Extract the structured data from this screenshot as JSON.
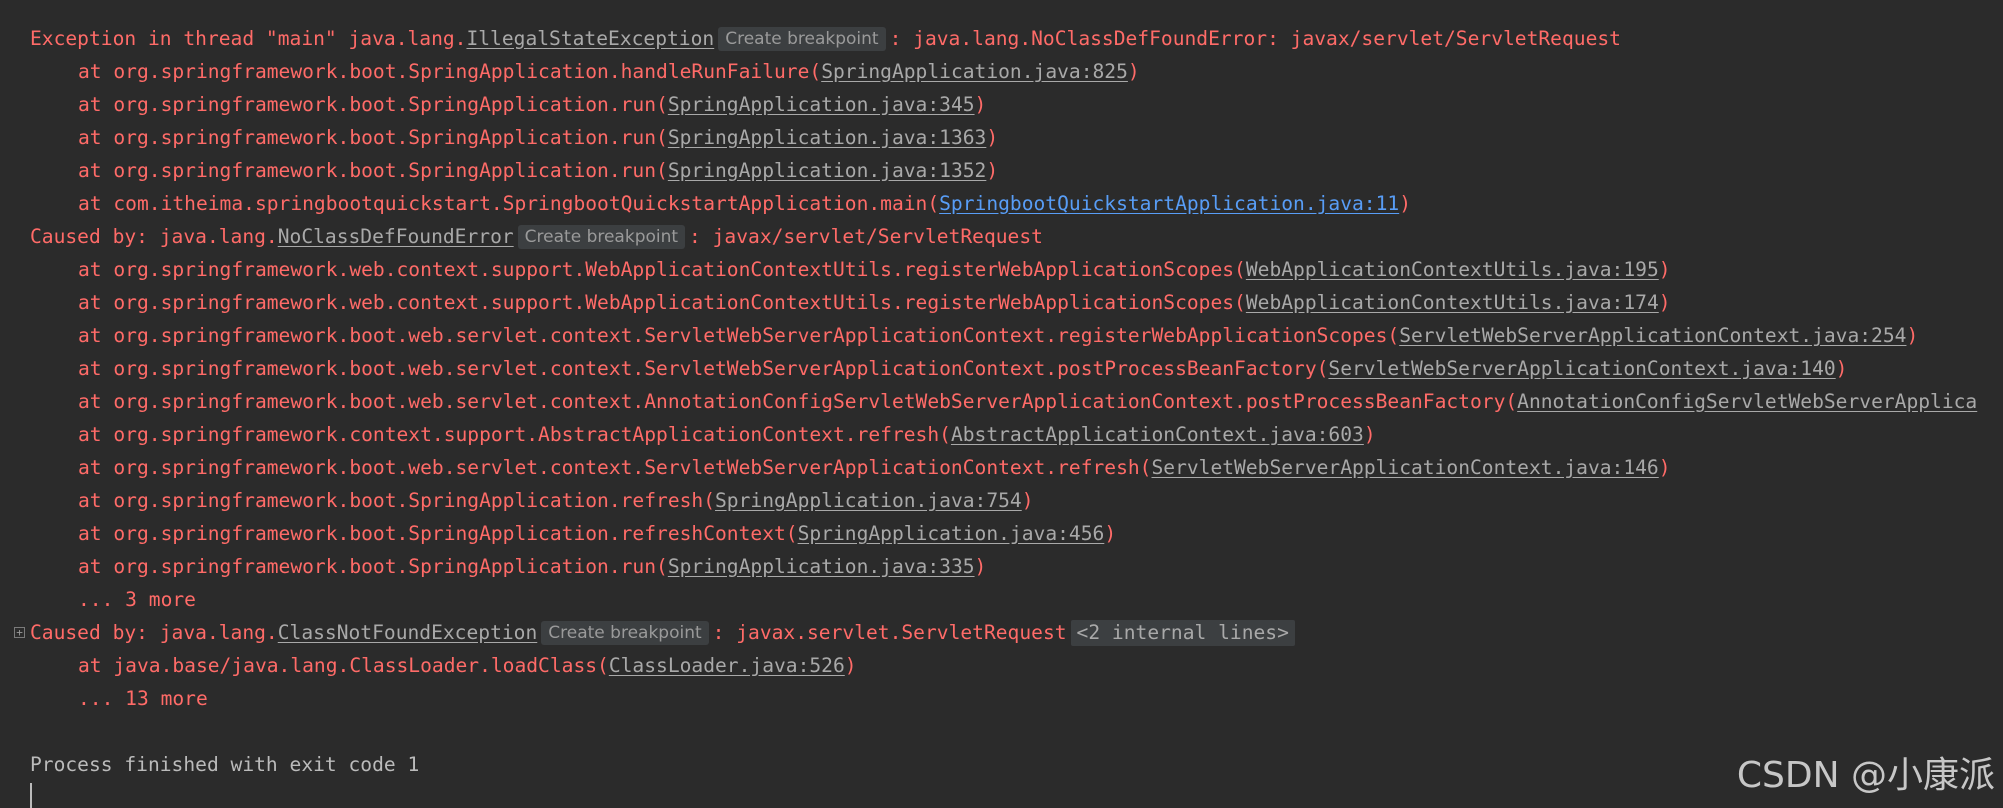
{
  "console": {
    "l1": {
      "prefix": "Exception in thread \"main\" java.lang.",
      "exception": "IllegalStateException",
      "hint": "Create breakpoint",
      "suffix": ": java.lang.NoClassDefFoundError: javax/servlet/ServletRequest"
    },
    "frames1": [
      {
        "method": "at org.springframework.boot.SpringApplication.handleRunFailure(",
        "location": "SpringApplication.java:825",
        "tail": ")"
      },
      {
        "method": "at org.springframework.boot.SpringApplication.run(",
        "location": "SpringApplication.java:345",
        "tail": ")"
      },
      {
        "method": "at org.springframework.boot.SpringApplication.run(",
        "location": "SpringApplication.java:1363",
        "tail": ")"
      },
      {
        "method": "at org.springframework.boot.SpringApplication.run(",
        "location": "SpringApplication.java:1352",
        "tail": ")"
      },
      {
        "method": "at com.itheima.springbootquickstart.SpringbootQuickstartApplication.main(",
        "location": "SpringbootQuickstartApplication.java:11",
        "tail": ")"
      }
    ],
    "cause1": {
      "prefix": "Caused by: java.lang.",
      "exception": "NoClassDefFoundError",
      "hint": "Create breakpoint",
      "suffix": ": javax/servlet/ServletRequest"
    },
    "frames2": [
      {
        "method": "at org.springframework.web.context.support.WebApplicationContextUtils.registerWebApplicationScopes(",
        "location": "WebApplicationContextUtils.java:195",
        "tail": ")"
      },
      {
        "method": "at org.springframework.web.context.support.WebApplicationContextUtils.registerWebApplicationScopes(",
        "location": "WebApplicationContextUtils.java:174",
        "tail": ")"
      },
      {
        "method": "at org.springframework.boot.web.servlet.context.ServletWebServerApplicationContext.registerWebApplicationScopes(",
        "location": "ServletWebServerApplicationContext.java:254",
        "tail": ")"
      },
      {
        "method": "at org.springframework.boot.web.servlet.context.ServletWebServerApplicationContext.postProcessBeanFactory(",
        "location": "ServletWebServerApplicationContext.java:140",
        "tail": ")"
      },
      {
        "method": "at org.springframework.boot.web.servlet.context.AnnotationConfigServletWebServerApplicationContext.postProcessBeanFactory(",
        "location": "AnnotationConfigServletWebServerApplica",
        "tail": ""
      },
      {
        "method": "at org.springframework.context.support.AbstractApplicationContext.refresh(",
        "location": "AbstractApplicationContext.java:603",
        "tail": ")"
      },
      {
        "method": "at org.springframework.boot.web.servlet.context.ServletWebServerApplicationContext.refresh(",
        "location": "ServletWebServerApplicationContext.java:146",
        "tail": ")"
      },
      {
        "method": "at org.springframework.boot.SpringApplication.refresh(",
        "location": "SpringApplication.java:754",
        "tail": ")"
      },
      {
        "method": "at org.springframework.boot.SpringApplication.refreshContext(",
        "location": "SpringApplication.java:456",
        "tail": ")"
      },
      {
        "method": "at org.springframework.boot.SpringApplication.run(",
        "location": "SpringApplication.java:335",
        "tail": ")"
      }
    ],
    "more1": "... 3 more",
    "cause2": {
      "prefix": "Caused by: java.lang.",
      "exception": "ClassNotFoundException",
      "hint": "Create breakpoint",
      "suffix": ": javax.servlet.ServletRequest",
      "folded": "<2 internal lines>"
    },
    "frame3": {
      "method": "at java.base/java.lang.ClassLoader.loadClass(",
      "location": "ClassLoader.java:526",
      "tail": ")"
    },
    "more2": "... 13 more",
    "exit": "Process finished with exit code 1"
  },
  "watermark": "CSDN @小康派",
  "colors": {
    "background": "#2b2b2b",
    "error": "#ff6b68",
    "link": "#a9a9a9",
    "active_link": "#589df6",
    "plain": "#bbbbbb"
  }
}
